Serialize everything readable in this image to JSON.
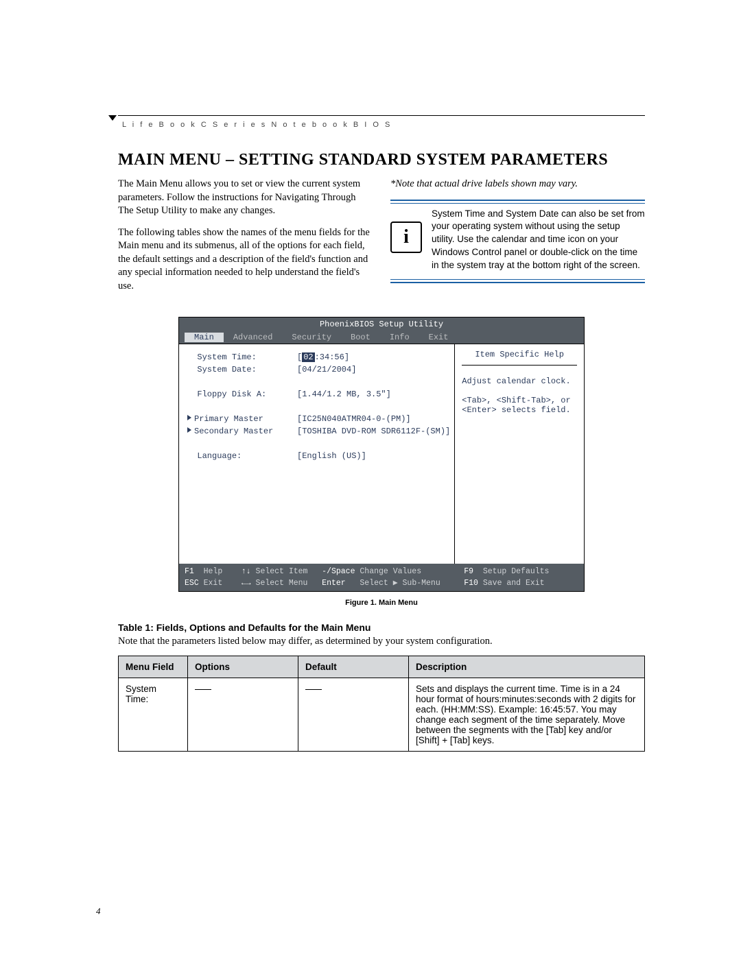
{
  "running_head": "L i f e B o o k   C   S e r i e s   N o t e b o o k   B I O S",
  "title": "MAIN MENU – SETTING STANDARD SYSTEM PARAMETERS",
  "left_col": {
    "p1": "The Main Menu allows you to set or view the current system parameters. Follow the instructions for Navigating Through The Setup Utility to make any changes.",
    "p2": "The following tables show the names of the menu fields for the Main menu and its submenus, all of the options for each field, the default settings and a description of the field's function and any special information needed to help understand the field's use."
  },
  "right_col": {
    "note": "*Note that actual drive labels shown may vary.",
    "info_icon": "i",
    "info_text": "System Time and System Date can also be set from your operating system without using the setup utility. Use the calendar and time icon on your Windows Control panel or double-click on the time in the system tray at the bottom right of the screen."
  },
  "bios": {
    "title": "PhoenixBIOS Setup Utility",
    "tabs": [
      "Main",
      "Advanced",
      "Security",
      "Boot",
      "Info",
      "Exit"
    ],
    "active_tab": "Main",
    "fields": [
      {
        "label": "System Time:",
        "value": "[",
        "hl": "02",
        "value2": ":34:56]"
      },
      {
        "label": "System Date:",
        "value": "[04/21/2004]"
      },
      {
        "label": "",
        "value": ""
      },
      {
        "label": "Floppy Disk A:",
        "value": "[1.44/1.2 MB, 3.5\"]"
      },
      {
        "label": "",
        "value": ""
      },
      {
        "label": "Primary Master",
        "value": "[IC25N040ATMR04-0-(PM)]",
        "arrow": true
      },
      {
        "label": "Secondary Master",
        "value": "[TOSHIBA DVD-ROM SDR6112F-(SM)]",
        "arrow": true
      },
      {
        "label": "",
        "value": ""
      },
      {
        "label": "Language:",
        "value": "[English (US)]"
      }
    ],
    "help_title": "Item Specific Help",
    "help_lines": [
      "Adjust calendar clock.",
      "",
      "<Tab>, <Shift-Tab>, or",
      "<Enter> selects field."
    ],
    "footer_l1_a": "F1",
    "footer_l1_b": "Help",
    "footer_l1_c": "↑↓",
    "footer_l1_d": "Select Item",
    "footer_l1_e": "-/Space",
    "footer_l1_f": "Change Values",
    "footer_l1_g": "F9",
    "footer_l1_h": "Setup Defaults",
    "footer_l2_a": "ESC",
    "footer_l2_b": "Exit",
    "footer_l2_c": "←→",
    "footer_l2_d": "Select Menu",
    "footer_l2_e": "Enter",
    "footer_l2_f": "Select ▶ Sub-Menu",
    "footer_l2_g": "F10",
    "footer_l2_h": "Save and Exit"
  },
  "figure_caption": "Figure 1.  Main Menu",
  "table_title": "Table 1: Fields, Options and Defaults for the Main Menu",
  "table_note": "Note that the parameters listed below may differ, as determined by your system configuration.",
  "table": {
    "headers": [
      "Menu Field",
      "Options",
      "Default",
      "Description"
    ],
    "rows": [
      {
        "field": "System Time:",
        "options": "—",
        "default": "—",
        "description": "Sets and displays the current time. Time is in a 24 hour format of hours:minutes:seconds with 2 digits for each. (HH:MM:SS). Example: 16:45:57. You may change each segment of the time separately. Move between the segments with the [Tab] key and/or [Shift] + [Tab] keys."
      }
    ]
  },
  "page_number": "4"
}
